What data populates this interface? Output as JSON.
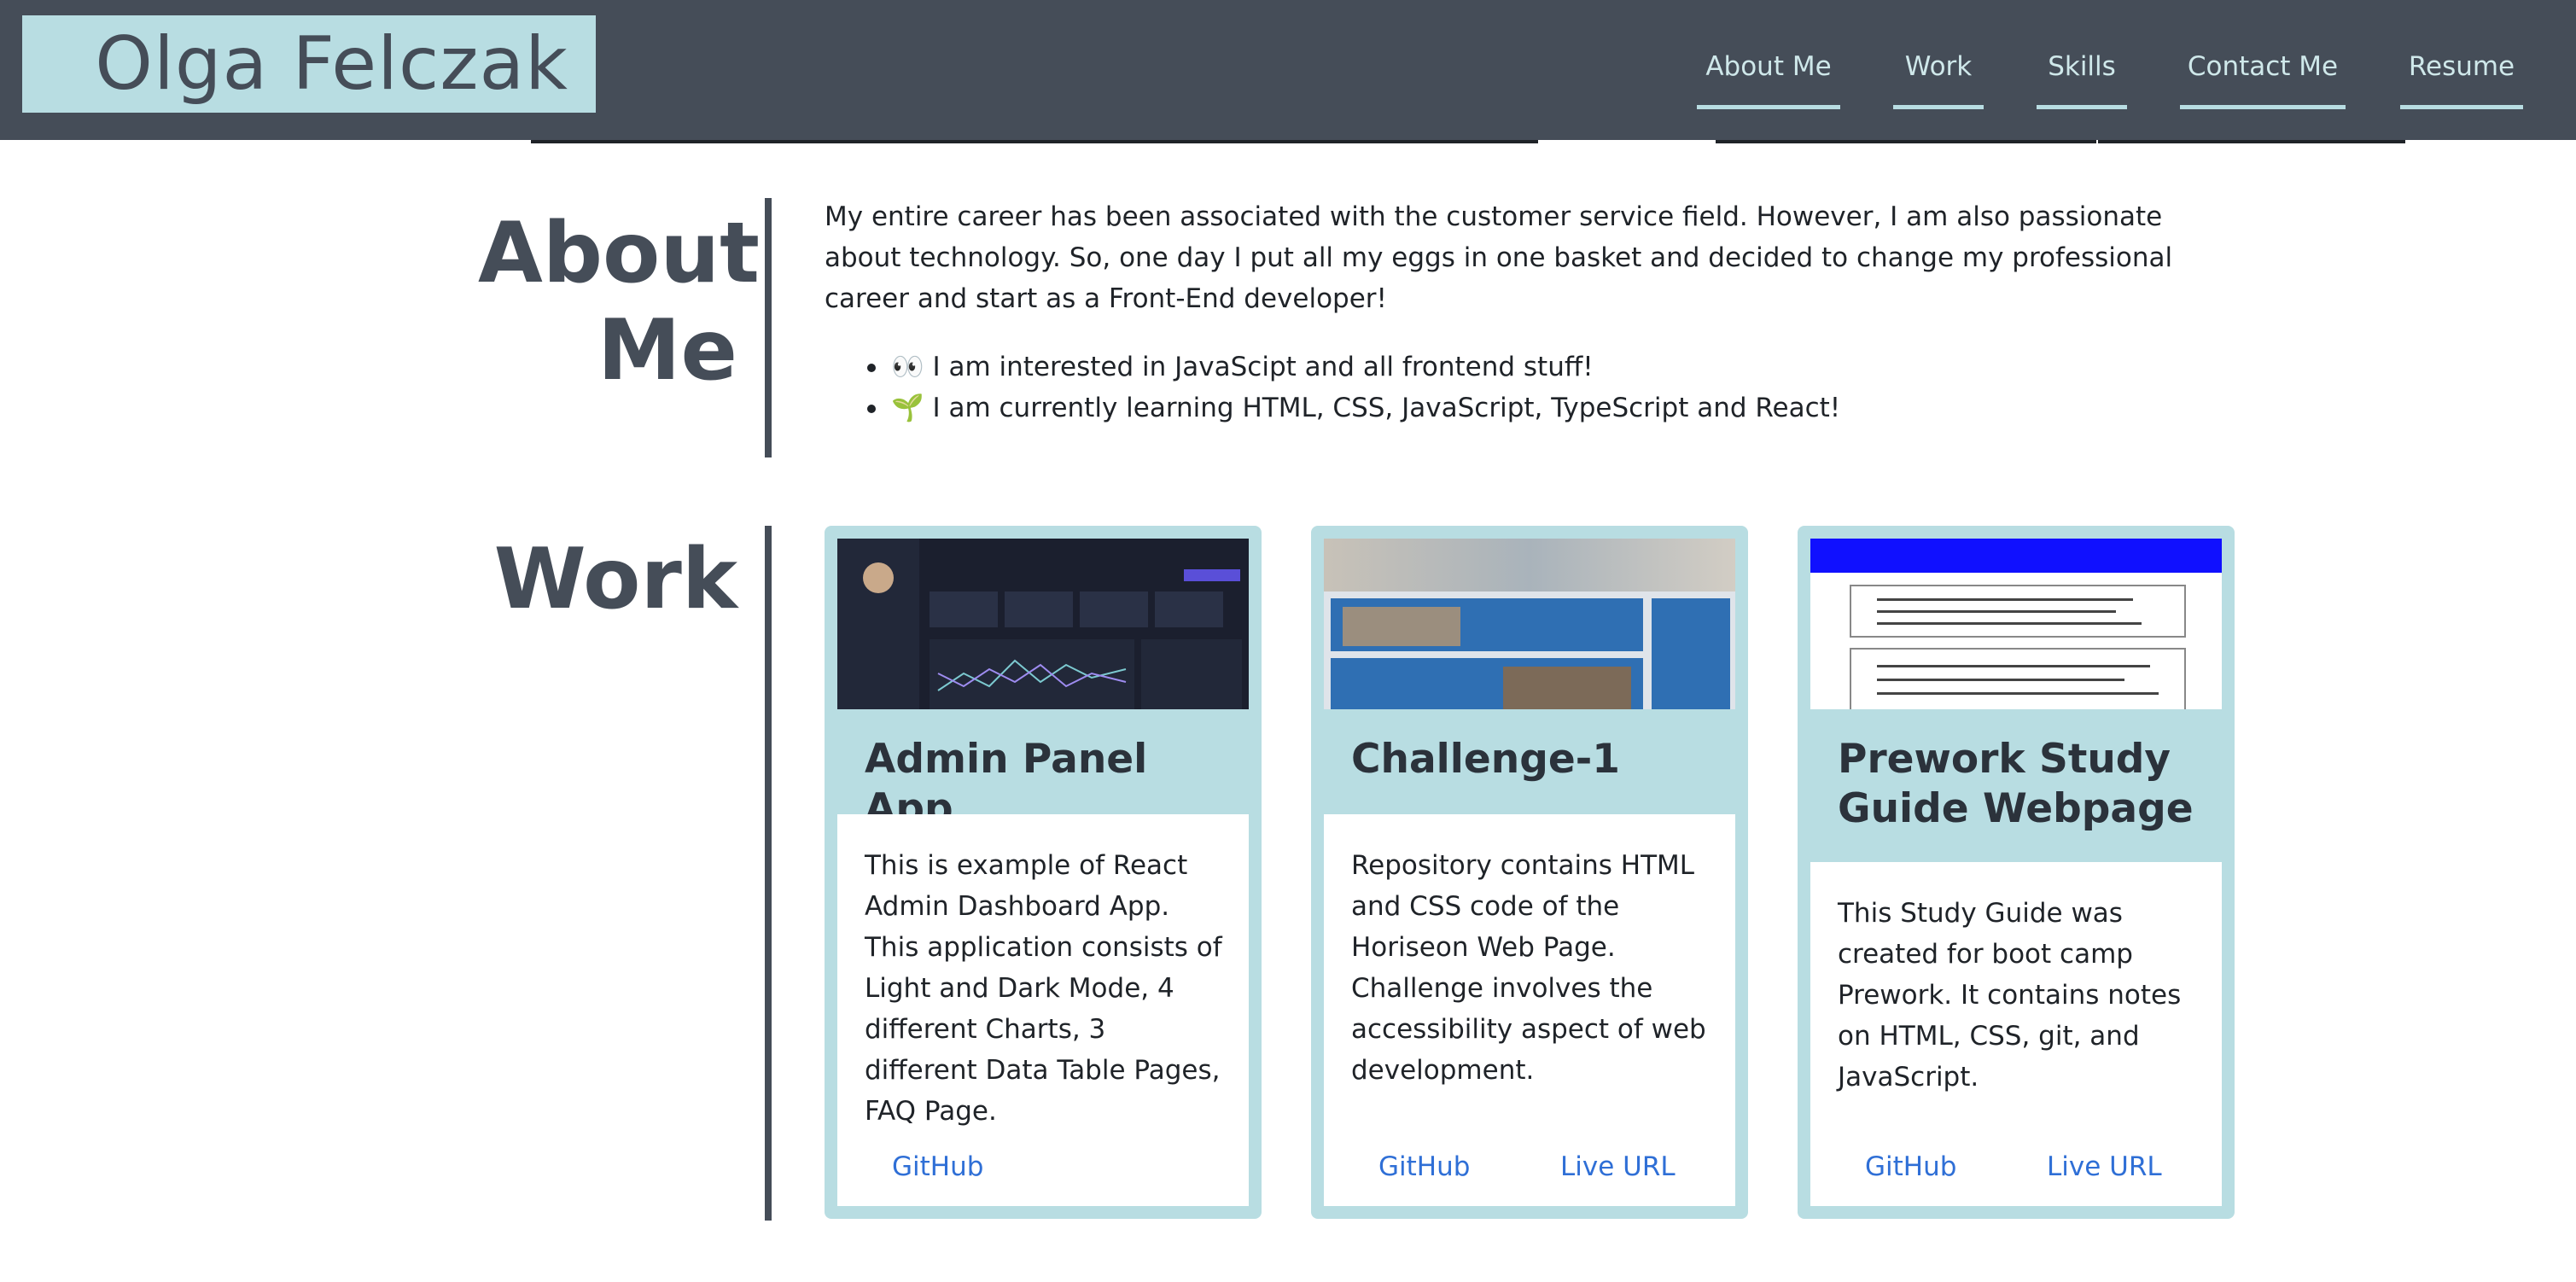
{
  "header": {
    "logo": "Olga Felczak",
    "nav": [
      "About Me",
      "Work",
      "Skills",
      "Contact Me",
      "Resume"
    ]
  },
  "about": {
    "title_line1": "About",
    "title_line2": "Me",
    "paragraph": "My entire career has been associated with the customer service field. However, I am also passionate about technology. So, one day I put all my eggs in one basket and decided to change my professional career and start as a Front-End developer!",
    "bullets": [
      "👀 I am interested in JavaScipt and all frontend stuff!",
      "🌱 I am currently learning HTML, CSS, JavaScript, TypeScript and React!"
    ]
  },
  "work": {
    "title": "Work",
    "cards": [
      {
        "title": "Admin Panel App",
        "description": "This is example of React Admin Dashboard App. This application consists of Light and Dark Mode, 4 different Charts, 3 different Data Table Pages, FAQ Page.",
        "github": "GitHub",
        "live": ""
      },
      {
        "title": "Challenge-1",
        "description": "Repository contains HTML and CSS code of the Horiseon Web Page. Challenge involves the accessibility aspect of web development.",
        "github": "GitHub",
        "live": "Live URL"
      },
      {
        "title": "Prework Study Guide Webpage",
        "description": "This Study Guide was created for boot camp Prework. It contains notes on HTML, CSS, git, and JavaScript.",
        "github": "GitHub",
        "live": "Live URL"
      }
    ]
  },
  "colors": {
    "header_bg": "#454d58",
    "accent": "#b8dde2",
    "link": "#2f6fd6"
  }
}
